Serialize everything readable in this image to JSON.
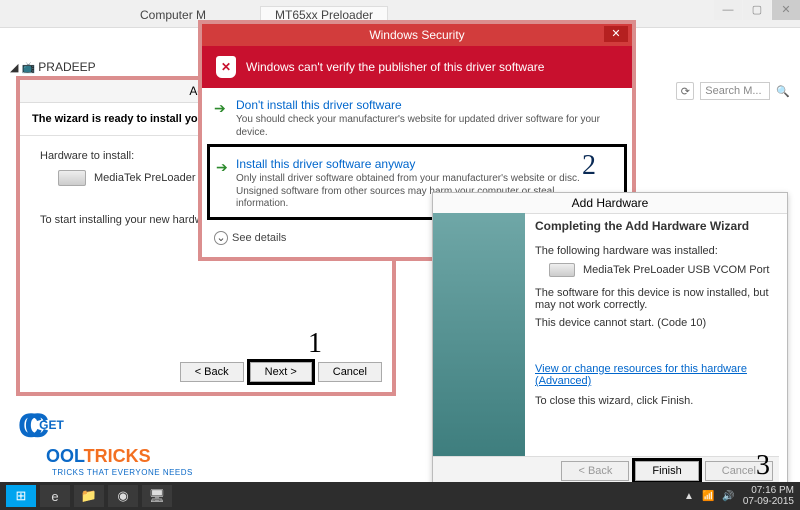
{
  "bg": {
    "tab1": "Computer M",
    "tab2": "MT65xx Preloader",
    "search_placeholder": "Search M...",
    "node": "PRADEEP"
  },
  "wiz1": {
    "title": "Add H",
    "head": "The wizard is ready to install your hardware",
    "label_hw": "Hardware to install:",
    "hw_name": "MediaTek PreLoader USB VCOM",
    "start": "To start installing your new hardware, click",
    "back": "< Back",
    "next": "Next >",
    "cancel": "Cancel"
  },
  "sec": {
    "title": "Windows Security",
    "warn": "Windows can't verify the publisher of this driver software",
    "opt1_t": "Don't install this driver software",
    "opt1_s": "You should check your manufacturer's website for updated driver software for your device.",
    "opt2_t": "Install this driver software anyway",
    "opt2_s": "Only install driver software obtained from your manufacturer's website or disc. Unsigned software from other sources may harm your computer or steal information.",
    "see": "See details"
  },
  "wiz3": {
    "title": "Add Hardware",
    "heading": "Completing the Add Hardware Wizard",
    "p1": "The following hardware was installed:",
    "hw": "MediaTek PreLoader USB VCOM Port",
    "p2": "The software for this device is now installed, but may not work correctly.",
    "p3": "This device cannot start. (Code 10)",
    "link": "View or change resources for this hardware (Advanced)",
    "p4": "To close this wizard, click Finish.",
    "back": "< Back",
    "finish": "Finish",
    "cancel": "Cancel"
  },
  "logo": {
    "get": "GET",
    "ool": "OOL",
    "tricks": "TRICKS",
    "tag": "TRICKS THAT EVERYONE NEEDS"
  },
  "taskbar": {
    "time": "07:16 PM",
    "date": "07-09-2015"
  },
  "ann": {
    "a1": "1",
    "a2": "2",
    "a3": "3"
  }
}
